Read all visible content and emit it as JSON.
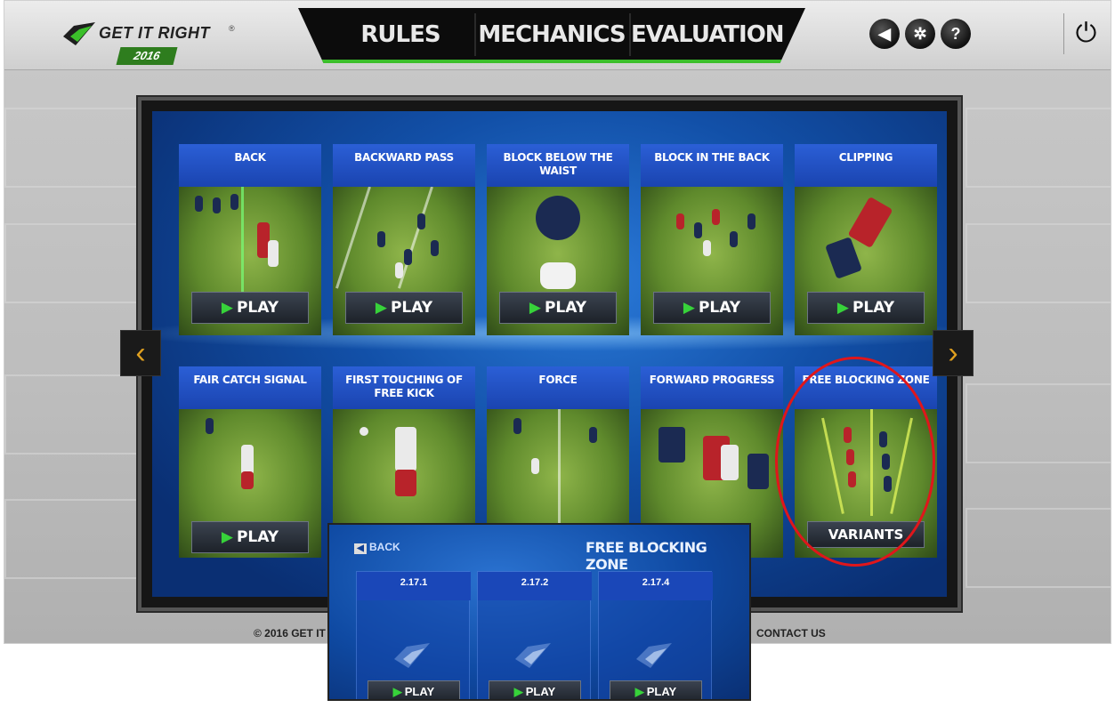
{
  "app": {
    "logo_text": "GET IT RIGHT",
    "logo_reg": "®",
    "year": "2016"
  },
  "nav": {
    "tabs": [
      "RULES",
      "MECHANICS",
      "EVALUATION"
    ]
  },
  "toolbar": {
    "sound_icon": "speaker-icon",
    "settings_icon": "gear-icon",
    "help_icon": "question-icon",
    "power_icon": "power-icon"
  },
  "grid": {
    "play_label": "PLAY",
    "variants_label": "VARIANTS",
    "cards": [
      {
        "title": "BACK"
      },
      {
        "title": "BACKWARD PASS"
      },
      {
        "title": "BLOCK BELOW THE WAIST"
      },
      {
        "title": "BLOCK IN THE BACK"
      },
      {
        "title": "CLIPPING"
      },
      {
        "title": "FAIR CATCH SIGNAL"
      },
      {
        "title": "FIRST TOUCHING OF FREE KICK"
      },
      {
        "title": "FORCE"
      },
      {
        "title": "FORWARD PROGRESS"
      },
      {
        "title": "FREE BLOCKING ZONE"
      }
    ]
  },
  "footer": {
    "copyright": "© 2016 GET IT R",
    "contact": "CONTACT US"
  },
  "overlay": {
    "back_label": "BACK",
    "title": "FREE BLOCKING ZONE",
    "play_label": "PLAY",
    "variants": [
      {
        "title": "2.17.1"
      },
      {
        "title": "2.17.2"
      },
      {
        "title": "2.17.4"
      }
    ]
  },
  "colors": {
    "accent_green": "#3bbf2a",
    "screen_blue": "#1250a8",
    "highlight_red": "#e0161b"
  }
}
